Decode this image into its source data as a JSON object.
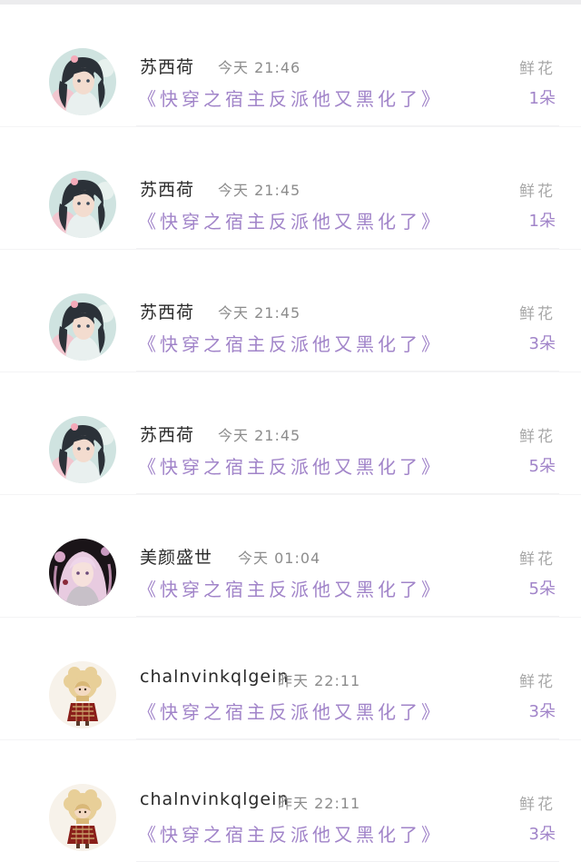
{
  "gift_records": [
    {
      "user": "苏西荷",
      "time": "今天 21:46",
      "book": "《快穿之宿主反派他又黑化了》",
      "gift": "鲜花",
      "count": "1朵",
      "avatar": "anime-girl-dark-hair-avatar"
    },
    {
      "user": "苏西荷",
      "time": "今天 21:45",
      "book": "《快穿之宿主反派他又黑化了》",
      "gift": "鲜花",
      "count": "1朵",
      "avatar": "anime-girl-dark-hair-avatar"
    },
    {
      "user": "苏西荷",
      "time": "今天 21:45",
      "book": "《快穿之宿主反派他又黑化了》",
      "gift": "鲜花",
      "count": "3朵",
      "avatar": "anime-girl-dark-hair-avatar"
    },
    {
      "user": "苏西荷",
      "time": "今天 21:45",
      "book": "《快穿之宿主反派他又黑化了》",
      "gift": "鲜花",
      "count": "5朵",
      "avatar": "anime-girl-dark-hair-avatar"
    },
    {
      "user": "美颜盛世",
      "time": "今天 01:04",
      "book": "《快穿之宿主反派他又黑化了》",
      "gift": "鲜花",
      "count": "5朵",
      "avatar": "anime-girl-pink-hair-avatar"
    },
    {
      "user": "chalnvinkqlgein",
      "time": "昨天 22:11",
      "book": "《快穿之宿主反派他又黑化了》",
      "gift": "鲜花",
      "count": "3朵",
      "avatar": "curly-hair-girl-avatar"
    },
    {
      "user": "chalnvinkqlgein",
      "time": "昨天 22:11",
      "book": "《快穿之宿主反派他又黑化了》",
      "gift": "鲜花",
      "count": "3朵",
      "avatar": "curly-hair-girl-avatar"
    }
  ],
  "colors": {
    "book_title": "#a184c9",
    "gift_count": "#a184c9",
    "username": "#2a2a2a",
    "meta": "#8c8c8c",
    "background": "#f4f4f5"
  }
}
